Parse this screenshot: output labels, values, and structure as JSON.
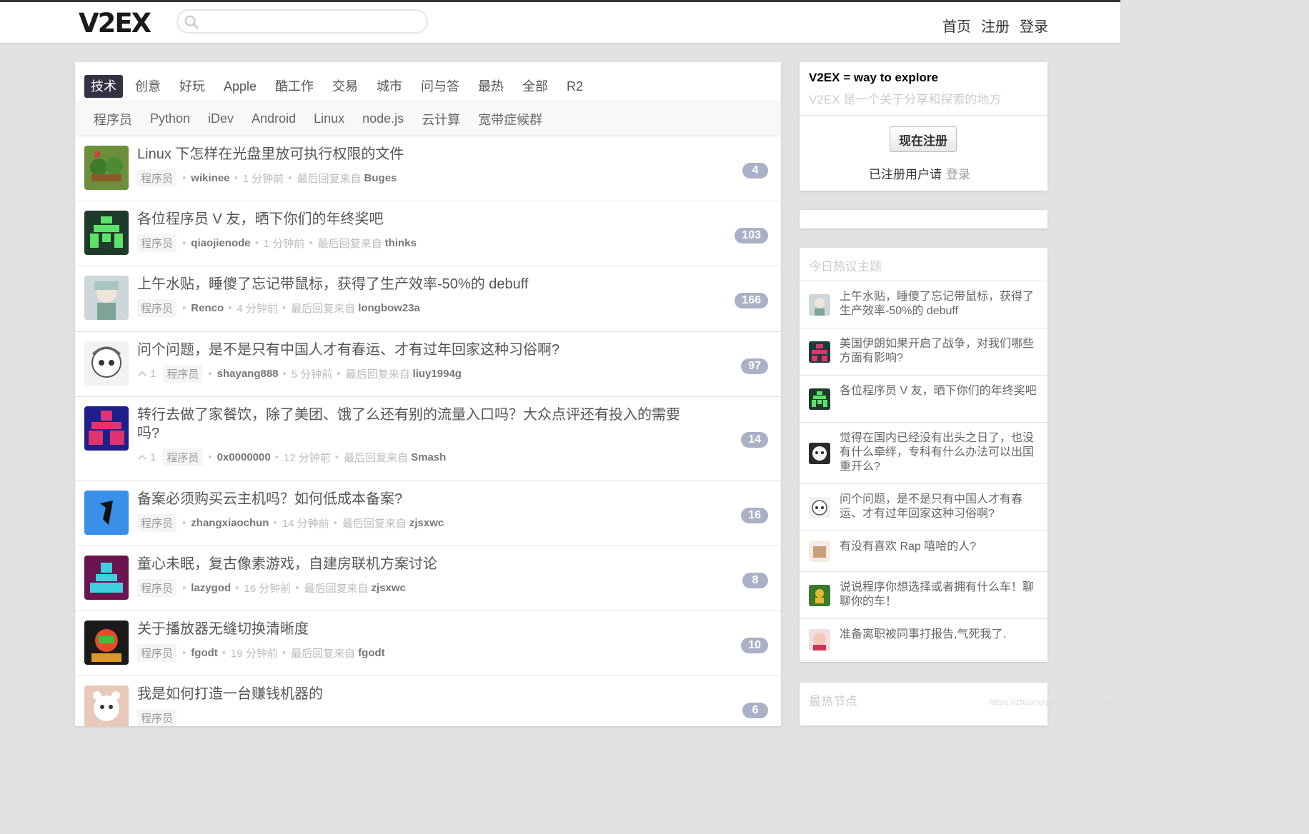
{
  "header": {
    "logo": "V2EX",
    "search_placeholder": "",
    "nav": [
      "首页",
      "注册",
      "登录"
    ]
  },
  "tabs": [
    "技术",
    "创意",
    "好玩",
    "Apple",
    "酷工作",
    "交易",
    "城市",
    "问与答",
    "最热",
    "全部",
    "R2"
  ],
  "active_tab": "技术",
  "subtabs": [
    "程序员",
    "Python",
    "iDev",
    "Android",
    "Linux",
    "node.js",
    "云计算",
    "宽带症候群"
  ],
  "topics": [
    {
      "title": "Linux 下怎样在光盘里放可执行权限的文件",
      "node": "程序员",
      "author": "wikinee",
      "ago": "1 分钟前",
      "last_prefix": "最后回复来自",
      "last_reply": "Buges",
      "replies": "4",
      "votes": ""
    },
    {
      "title": "各位程序员 V 友，晒下你们的年终奖吧",
      "node": "程序员",
      "author": "qiaojienode",
      "ago": "1 分钟前",
      "last_prefix": "最后回复来自",
      "last_reply": "thinks",
      "replies": "103",
      "votes": ""
    },
    {
      "title": "上午水贴，睡傻了忘记带鼠标，获得了生产效率-50%的 debuff",
      "node": "程序员",
      "author": "Renco",
      "ago": "4 分钟前",
      "last_prefix": "最后回复来自",
      "last_reply": "longbow23a",
      "replies": "166",
      "votes": ""
    },
    {
      "title": "问个问题，是不是只有中国人才有春运、才有过年回家这种习俗啊?",
      "node": "程序员",
      "author": "shayang888",
      "ago": "5 分钟前",
      "last_prefix": "最后回复来自",
      "last_reply": "liuy1994g",
      "replies": "97",
      "votes": "1"
    },
    {
      "title": "转行去做了家餐饮，除了美团、饿了么还有别的流量入口吗？大众点评还有投入的需要吗?",
      "node": "程序员",
      "author": "0x0000000",
      "ago": "12 分钟前",
      "last_prefix": "最后回复来自",
      "last_reply": "Smash",
      "replies": "14",
      "votes": "1"
    },
    {
      "title": "备案必须购买云主机吗？如何低成本备案?",
      "node": "程序员",
      "author": "zhangxiaochun",
      "ago": "14 分钟前",
      "last_prefix": "最后回复来自",
      "last_reply": "zjsxwc",
      "replies": "16",
      "votes": ""
    },
    {
      "title": "童心未眠，复古像素游戏，自建房联机方案讨论",
      "node": "程序员",
      "author": "lazygod",
      "ago": "16 分钟前",
      "last_prefix": "最后回复来自",
      "last_reply": "zjsxwc",
      "replies": "8",
      "votes": ""
    },
    {
      "title": "关于播放器无缝切换清晰度",
      "node": "程序员",
      "author": "fgodt",
      "ago": "19 分钟前",
      "last_prefix": "最后回复来自",
      "last_reply": "fgodt",
      "replies": "10",
      "votes": ""
    },
    {
      "title": "我是如何打造一台赚钱机器的",
      "node": "程序员",
      "author": "",
      "ago": "",
      "last_prefix": "",
      "last_reply": "",
      "replies": "6",
      "votes": ""
    }
  ],
  "sidebar": {
    "slogan": "V2EX = way to explore",
    "description": "V2EX 是一个关于分享和探索的地方",
    "signup_button": "现在注册",
    "registered_text": "已注册用户请",
    "login_link": "登录",
    "hot_title": "今日热议主题",
    "hot_topics": [
      "上午水贴，睡傻了忘记带鼠标，获得了生产效率-50%的 debuff",
      "美国伊朗如果开启了战争，对我们哪些方面有影响?",
      "各位程序员 V 友，晒下你们的年终奖吧",
      "觉得在国内已经没有出头之日了，也没有什么牵绊，专科有什么办法可以出国重开么?",
      "问个问题，是不是只有中国人才有春运、才有过年回家这种习俗啊?",
      "有没有喜欢 Rap 嘻哈的人?",
      "说说程序你想选择或者拥有什么车！聊聊你的车！",
      "准备离职被同事打报告,气死我了."
    ],
    "nodes_title": "最热节点"
  },
  "watermark": "https://zhuangqing.blog.csdn.net",
  "colors": {
    "accent": "#334455",
    "count_badge": "#aab0c6"
  }
}
